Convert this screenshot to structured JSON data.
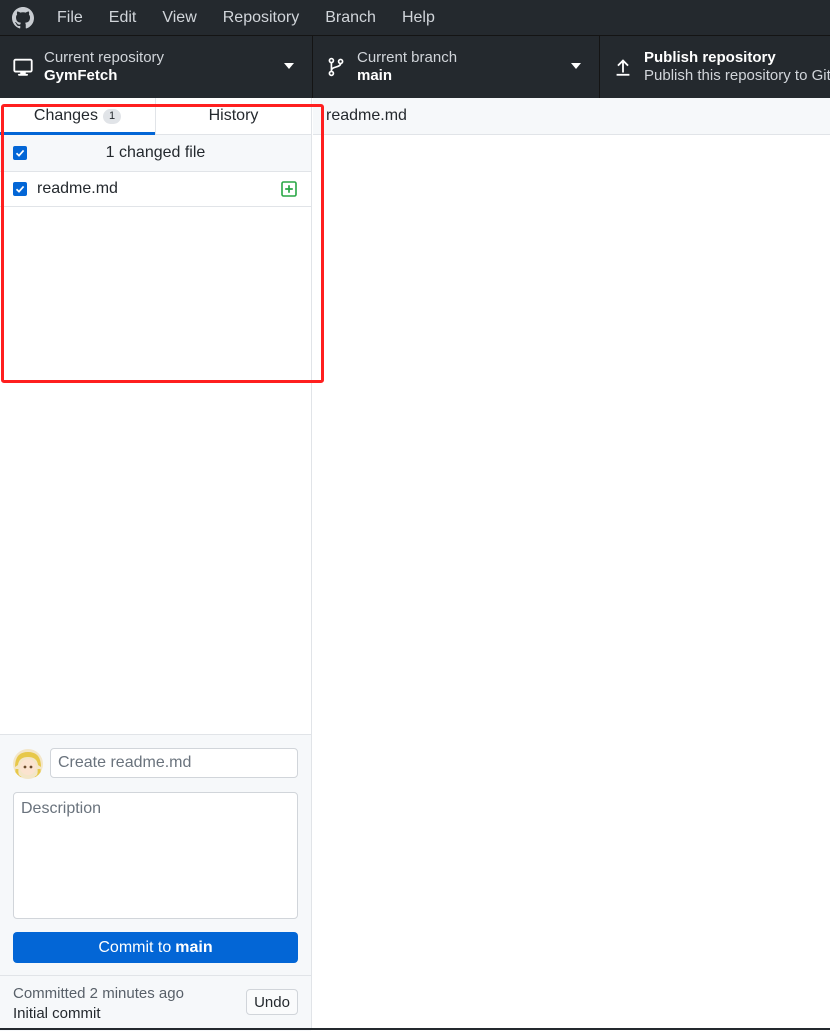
{
  "menu": {
    "items": [
      "File",
      "Edit",
      "View",
      "Repository",
      "Branch",
      "Help"
    ]
  },
  "toolbar": {
    "repository": {
      "label": "Current repository",
      "value": "GymFetch"
    },
    "branch": {
      "label": "Current branch",
      "value": "main"
    },
    "publish": {
      "title": "Publish repository",
      "description": "Publish this repository to GitHub"
    }
  },
  "sidebar": {
    "tabs": [
      {
        "label": "Changes",
        "count": "1",
        "selected": true
      },
      {
        "label": "History",
        "selected": false
      }
    ],
    "changes_header": "1 changed file",
    "files": [
      {
        "name": "readme.md",
        "status": "added",
        "checked": true
      }
    ]
  },
  "commit": {
    "summary_placeholder": "Create readme.md",
    "description_placeholder": "Description",
    "button_prefix": "Commit to",
    "button_branch": "main"
  },
  "last_commit": {
    "time": "Committed 2 minutes ago",
    "message": "Initial commit",
    "undo_label": "Undo"
  },
  "diff": {
    "path": "readme.md"
  },
  "colors": {
    "accent": "#0366d6",
    "added": "#28a745",
    "toolbar_bg": "#24292e",
    "highlight": "#ff1f1f"
  }
}
